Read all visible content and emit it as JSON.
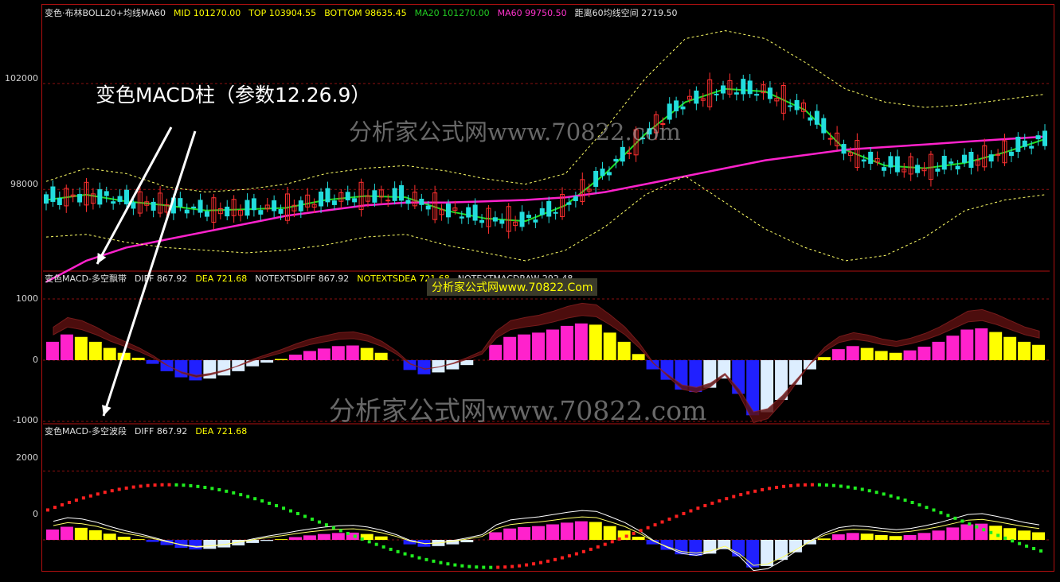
{
  "annotation": "变色MACD柱（参数12.26.9）",
  "watermarks": {
    "main": "分析家公式网www.70822.com",
    "macd": "分析家公式网www.70822.com",
    "badge": "分析家公式网www.70822.Com"
  },
  "panels": {
    "price": {
      "items": [
        {
          "text": "变色·布林BOLL20+均线MA60",
          "color": "#e0e0e0"
        },
        {
          "text": "MID 101270.00",
          "color": "#ffff00"
        },
        {
          "text": "TOP 103904.55",
          "color": "#ffff00"
        },
        {
          "text": "BOTTOM 98635.45",
          "color": "#ffff00"
        },
        {
          "text": "MA20 101270.00",
          "color": "#22cc22"
        },
        {
          "text": "MA60 99750.50",
          "color": "#ff33cc"
        },
        {
          "text": "距离60均线空间 2719.50",
          "color": "#e0e0e0"
        }
      ],
      "yticks": [
        "102000",
        "98000"
      ]
    },
    "macd_band": {
      "items": [
        {
          "text": "变色MACD-多空飘带",
          "color": "#e0e0e0"
        },
        {
          "text": "DIFF 867.92",
          "color": "#e0e0e0"
        },
        {
          "text": "DEA 721.68",
          "color": "#ffff00"
        },
        {
          "text": "NOTEXTSDIFF 867.92",
          "color": "#e0e0e0"
        },
        {
          "text": "NOTEXTSDEA 721.68",
          "color": "#ffff00"
        },
        {
          "text": "NOTEXTMACDRAW 292.48",
          "color": "#e0e0e0"
        }
      ],
      "yticks": [
        "1000",
        "0",
        "-1000"
      ]
    },
    "macd_wave": {
      "items": [
        {
          "text": "变色MACD-多空波段",
          "color": "#e0e0e0"
        },
        {
          "text": "DIFF 867.92",
          "color": "#e0e0e0"
        },
        {
          "text": "DEA 721.68",
          "color": "#ffff00"
        }
      ],
      "yticks": [
        "2000",
        "0"
      ]
    }
  },
  "colors": {
    "mid": "#22dd22",
    "ma60": "#ff22cc",
    "ma_slow": "#ee1111",
    "ma_blue": "#2222ff",
    "boll": "#ffff66",
    "up": "#ff22cc",
    "up2": "#ffff00",
    "dn": "#2020ff",
    "dn2": "#ddeeff",
    "candle_up": "#ff3030",
    "candle_dn": "#22dddd"
  },
  "chart_data": [
    {
      "type": "line",
      "title": "变色·布林BOLL20+均线MA60",
      "ylim": [
        95000,
        104500
      ],
      "yticks": [
        98000,
        102000
      ],
      "x": [
        0,
        10,
        20,
        30,
        40,
        50,
        60,
        70,
        80,
        90,
        100,
        110,
        120,
        130,
        140,
        150,
        160,
        170,
        180,
        190,
        200,
        210,
        220,
        230,
        240,
        250
      ],
      "series": [
        {
          "name": "MID",
          "values": [
            97600,
            97800,
            97550,
            97400,
            97200,
            97250,
            97300,
            97600,
            97750,
            97700,
            97200,
            96900,
            96800,
            97400,
            98600,
            100100,
            101300,
            101800,
            101700,
            101000,
            99500,
            98900,
            98800,
            99000,
            99400,
            99900
          ]
        },
        {
          "name": "MA60",
          "values": [
            94500,
            95300,
            95800,
            96100,
            96400,
            96700,
            97000,
            97200,
            97400,
            97500,
            97500,
            97550,
            97600,
            97700,
            97900,
            98200,
            98500,
            98800,
            99100,
            99300,
            99500,
            99600,
            99700,
            99800,
            99900,
            100000
          ]
        },
        {
          "name": "TOP",
          "values": [
            98300,
            98800,
            98600,
            98100,
            97900,
            98000,
            98200,
            98600,
            98800,
            98900,
            98700,
            98400,
            98200,
            98600,
            100300,
            102200,
            103700,
            104000,
            103700,
            102800,
            101800,
            101300,
            101100,
            101200,
            101400,
            101600
          ]
        },
        {
          "name": "BOTTOM",
          "values": [
            96200,
            96300,
            96000,
            95800,
            95700,
            95600,
            95700,
            95900,
            96200,
            96300,
            95900,
            95600,
            95300,
            95700,
            96600,
            97800,
            98500,
            97500,
            96500,
            95800,
            95300,
            95500,
            96200,
            97200,
            97600,
            97800
          ]
        }
      ]
    },
    {
      "type": "bar",
      "title": "变色MACD-多空飘带",
      "ylim": [
        -1000,
        1000
      ],
      "yticks": [
        -1000,
        0,
        1000
      ],
      "values": [
        300,
        420,
        380,
        300,
        200,
        120,
        40,
        -60,
        -180,
        -280,
        -330,
        -300,
        -250,
        -180,
        -100,
        -40,
        20,
        90,
        150,
        190,
        230,
        240,
        200,
        120,
        0,
        -160,
        -230,
        -200,
        -150,
        -80,
        0,
        250,
        380,
        420,
        450,
        500,
        560,
        600,
        580,
        450,
        300,
        100,
        -150,
        -320,
        -480,
        -520,
        -450,
        -300,
        -550,
        -900,
        -850,
        -650,
        -400,
        -150,
        50,
        180,
        230,
        200,
        150,
        120,
        160,
        220,
        300,
        400,
        500,
        520,
        460,
        380,
        300,
        250
      ]
    },
    {
      "type": "bar",
      "title": "变色MACD-多空波段",
      "ylim": [
        -900,
        2400
      ],
      "yticks": [
        0,
        2000
      ],
      "values": [
        300,
        380,
        350,
        280,
        180,
        90,
        20,
        -60,
        -150,
        -230,
        -280,
        -260,
        -220,
        -160,
        -90,
        -30,
        20,
        80,
        130,
        170,
        200,
        210,
        170,
        100,
        0,
        -130,
        -200,
        -180,
        -130,
        -70,
        0,
        220,
        330,
        370,
        400,
        450,
        500,
        540,
        520,
        400,
        270,
        90,
        -130,
        -290,
        -420,
        -460,
        -400,
        -270,
        -480,
        -800,
        -760,
        -580,
        -360,
        -130,
        40,
        160,
        200,
        180,
        140,
        110,
        140,
        200,
        270,
        360,
        450,
        470,
        410,
        340,
        270,
        220
      ]
    }
  ]
}
